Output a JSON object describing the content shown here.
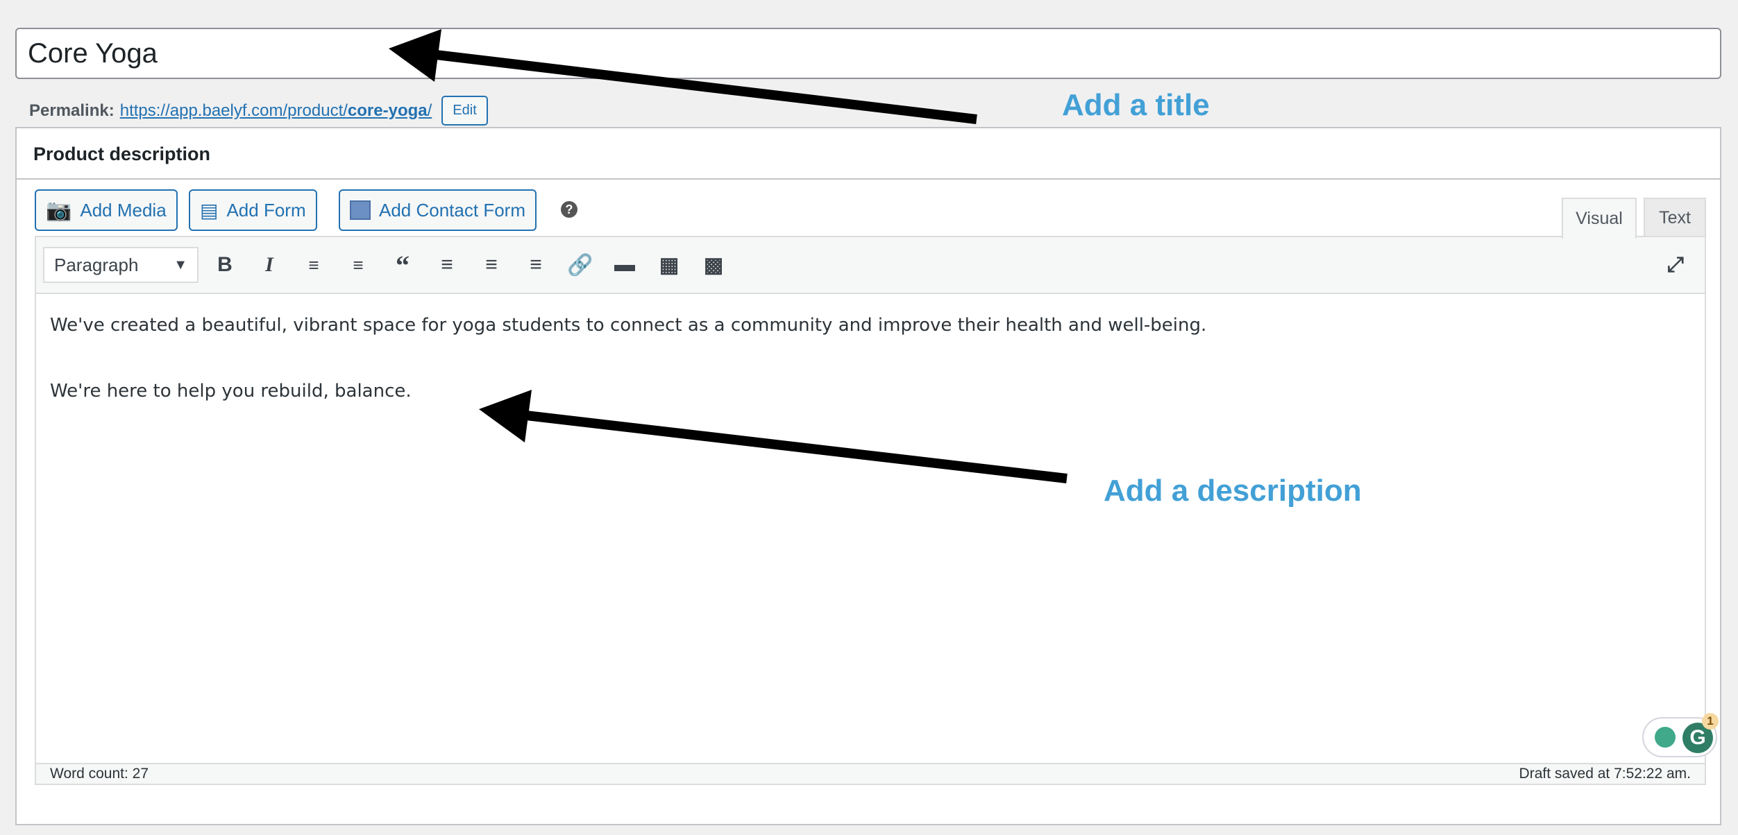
{
  "title_input": {
    "value": "Core Yoga"
  },
  "permalink": {
    "label": "Permalink:",
    "url_prefix": "https://app.baelyf.com/product/",
    "slug": "core-yoga",
    "url_suffix": "/",
    "edit_label": "Edit"
  },
  "box": {
    "heading": "Product description"
  },
  "media_buttons": [
    {
      "label": "Add Media",
      "icon": "add-media-icon"
    },
    {
      "label": "Add Form",
      "icon": "form-icon"
    },
    {
      "label": "Add Contact Form",
      "icon": "contact-form-icon"
    }
  ],
  "help_icon": "?",
  "tabs": [
    {
      "label": "Visual",
      "active": true
    },
    {
      "label": "Text",
      "active": false
    }
  ],
  "toolbar": {
    "format": "Paragraph",
    "buttons": [
      "bold",
      "italic",
      "bulleted-list",
      "numbered-list",
      "blockquote",
      "align-left",
      "align-center",
      "align-right",
      "link",
      "read-more",
      "toolbar-toggle",
      "form"
    ]
  },
  "content": {
    "paragraphs": [
      "We've created a beautiful, vibrant space for yoga students to connect as a community and improve their health and well-being.",
      "We're here to help you rebuild, balance."
    ]
  },
  "status": {
    "word_count": "Word count: 27",
    "draft": "Draft saved at 7:52:22 am."
  },
  "grammarly": {
    "badge": "1"
  },
  "annotations": {
    "title": "Add a title",
    "description": "Add a description",
    "color": "#42a0d6"
  }
}
